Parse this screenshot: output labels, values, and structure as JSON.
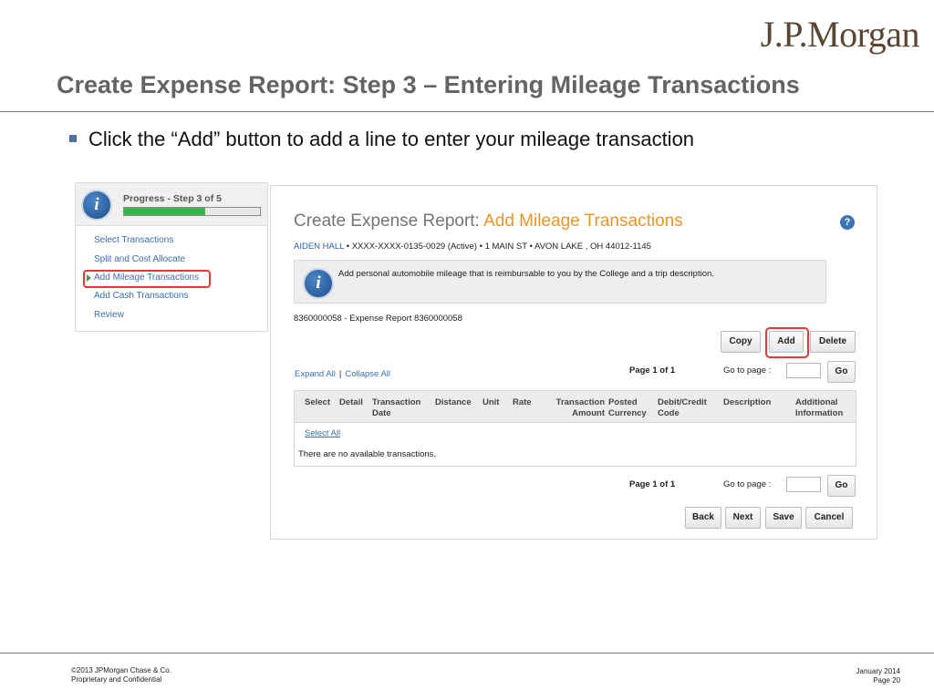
{
  "brand": {
    "logo_text": "J.P.Morgan"
  },
  "slide": {
    "title": "Create Expense Report: Step 3 – Entering Mileage Transactions",
    "bullet": "Click the “Add” button to add a line to enter your mileage transaction"
  },
  "progress_panel": {
    "label": "Progress - Step 3 of 5",
    "fill_fraction": 0.6,
    "steps": [
      "Select Transactions",
      "Split and Cost Allocate",
      "Add Mileage Transactions",
      "Add Cash Transactions",
      "Review"
    ],
    "current_step_index": 2
  },
  "main": {
    "heading_prefix": "Create Expense Report:",
    "heading_accent": "Add Mileage Transactions",
    "help_glyph": "?",
    "user_name": "AIDEN HALL",
    "user_details": "• XXXX-XXXX-0135-0029 (Active)  • 1 MAIN ST • AVON LAKE , OH 44012-1145",
    "info_glyph": "i",
    "info_text": "Add personal automobile mileage that is reimbursable to you by the College and a trip description.",
    "report_line": "8360000058 - Expense Report 8360000058",
    "buttons": {
      "copy": "Copy",
      "add": "Add",
      "delete": "Delete"
    },
    "expand_all": "Expand All",
    "separator": "|",
    "collapse_all": "Collapse All",
    "page_indicator": "Page 1 of 1",
    "goto_label": "Go to page :",
    "go": "Go",
    "table": {
      "columns": [
        "Select",
        "Detail",
        "Transaction\nDate",
        "Distance",
        "Unit",
        "Rate",
        "Transaction\nAmount",
        "Posted\nCurrency",
        "Debit/Credit\nCode",
        "Description",
        "Additional\nInformation"
      ],
      "select_all": "Select All",
      "empty_message": "There are no available transactions."
    },
    "nav_buttons": {
      "back": "Back",
      "next": "Next",
      "save": "Save",
      "cancel": "Cancel"
    }
  },
  "footer": {
    "copyright": "©2013 JPMorgan Chase & Co.",
    "confidential": "Proprietary and Confidential",
    "date": "January 2014",
    "page": "Page 20"
  }
}
